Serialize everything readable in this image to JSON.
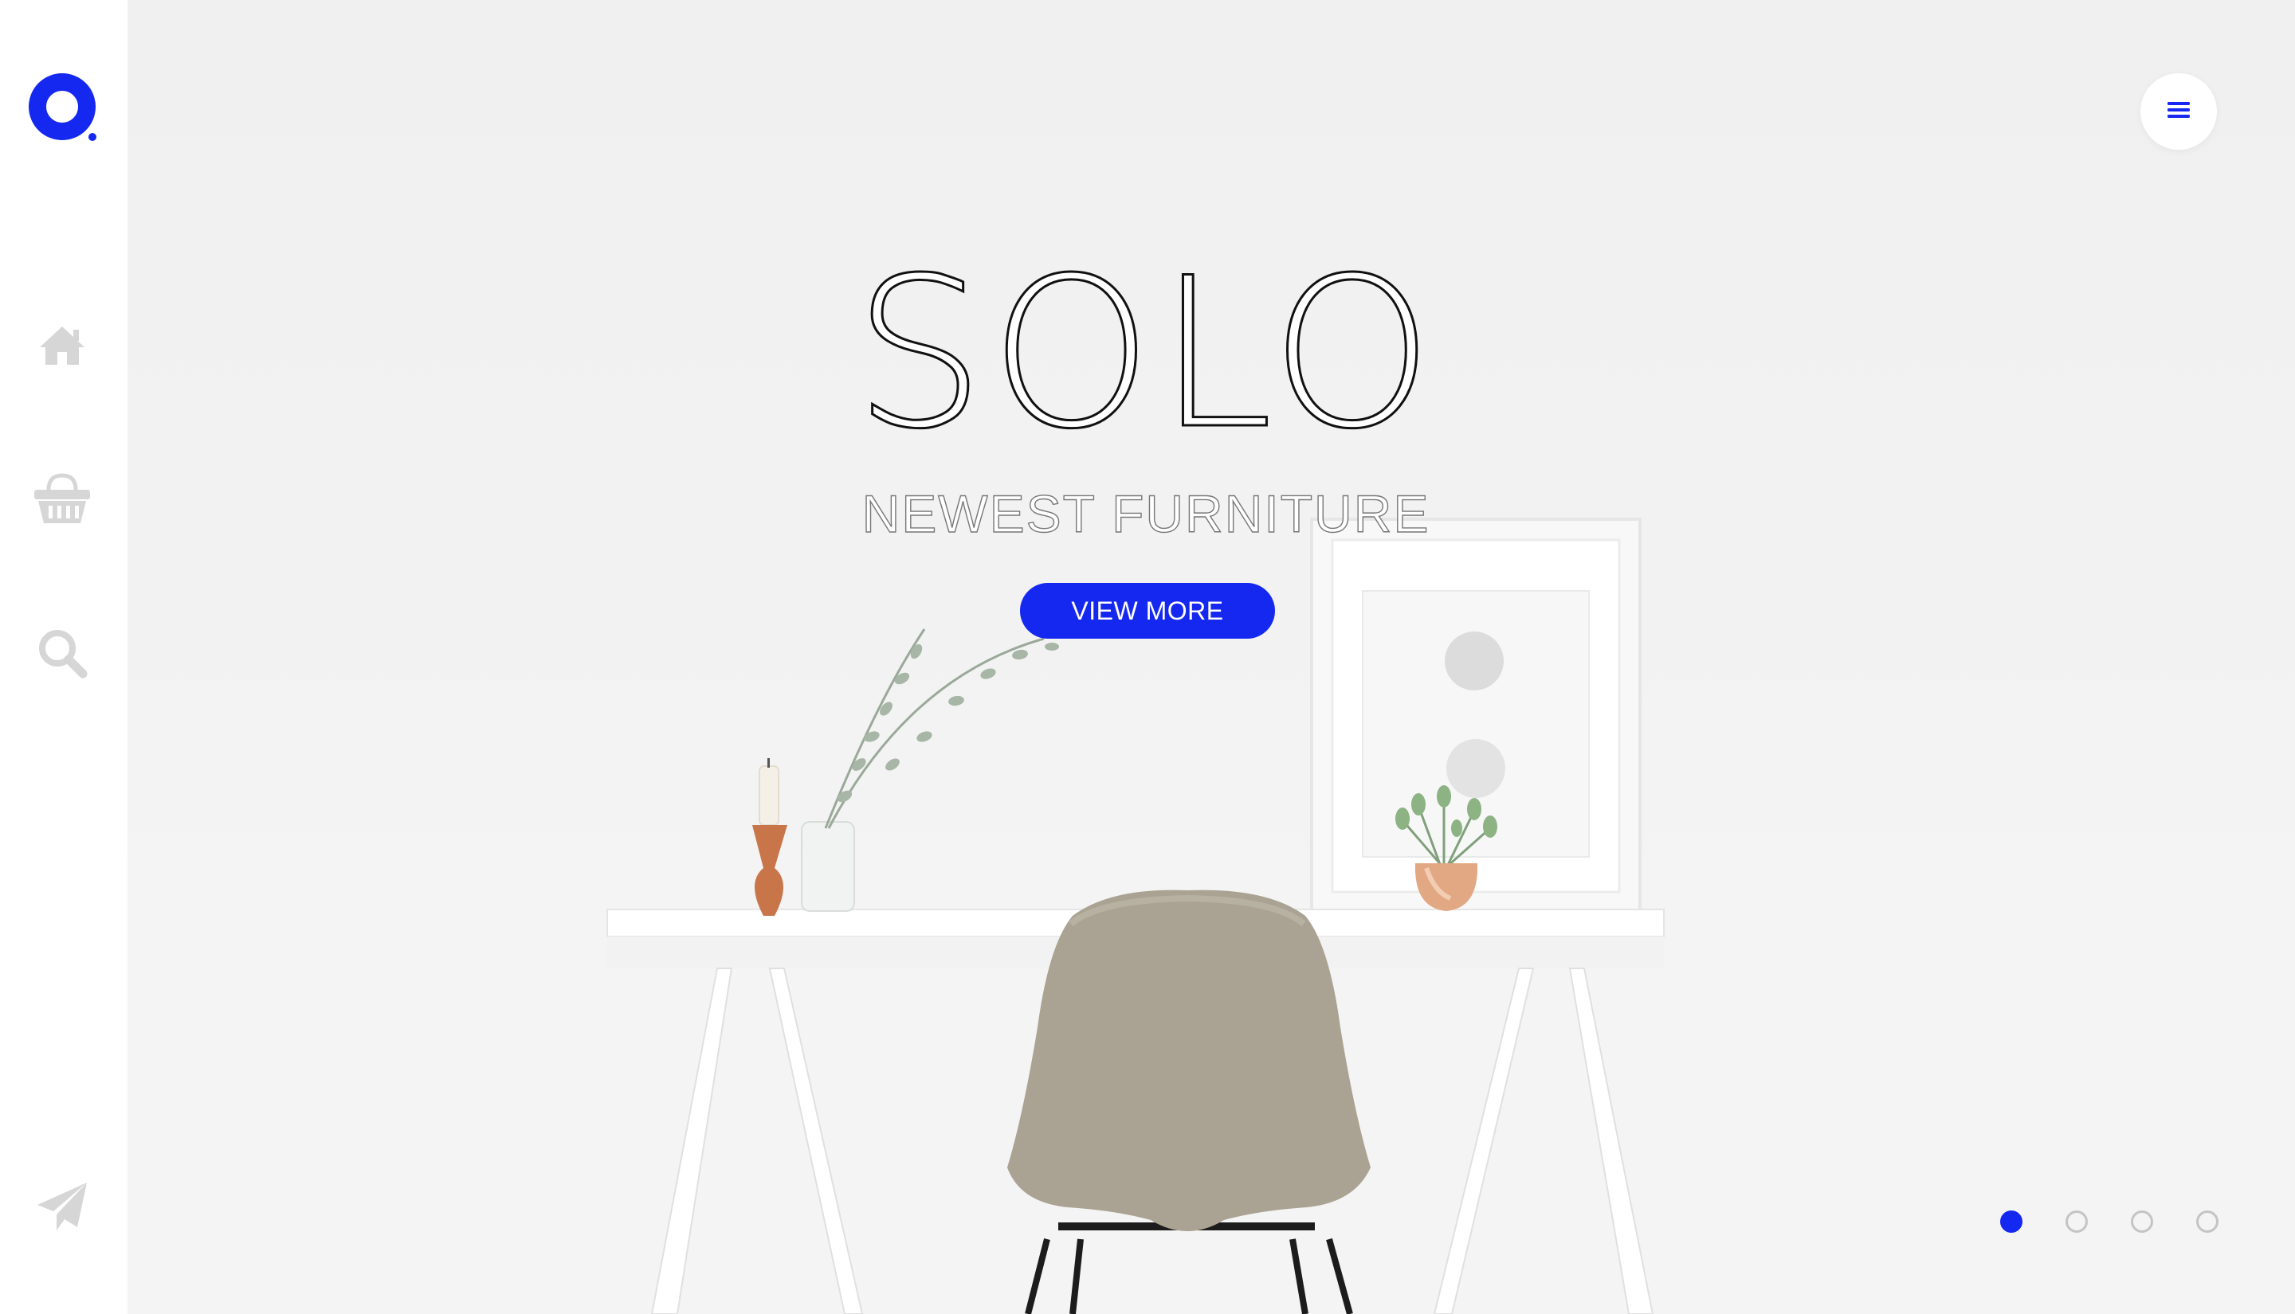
{
  "brand": {
    "accent_color": "#1428f0",
    "logo_icon": "ring-logo-icon"
  },
  "sidebar": {
    "items": [
      {
        "icon": "home-icon"
      },
      {
        "icon": "basket-icon"
      },
      {
        "icon": "search-icon"
      }
    ],
    "footer_icon": "paper-plane-icon"
  },
  "hero": {
    "title": "SOLO",
    "subtitle": "NEWEST FURNITURE",
    "cta_label": "VIEW MORE"
  },
  "menu": {
    "icon": "hamburger-menu-icon"
  },
  "slider": {
    "count": 4,
    "active_index": 0
  }
}
